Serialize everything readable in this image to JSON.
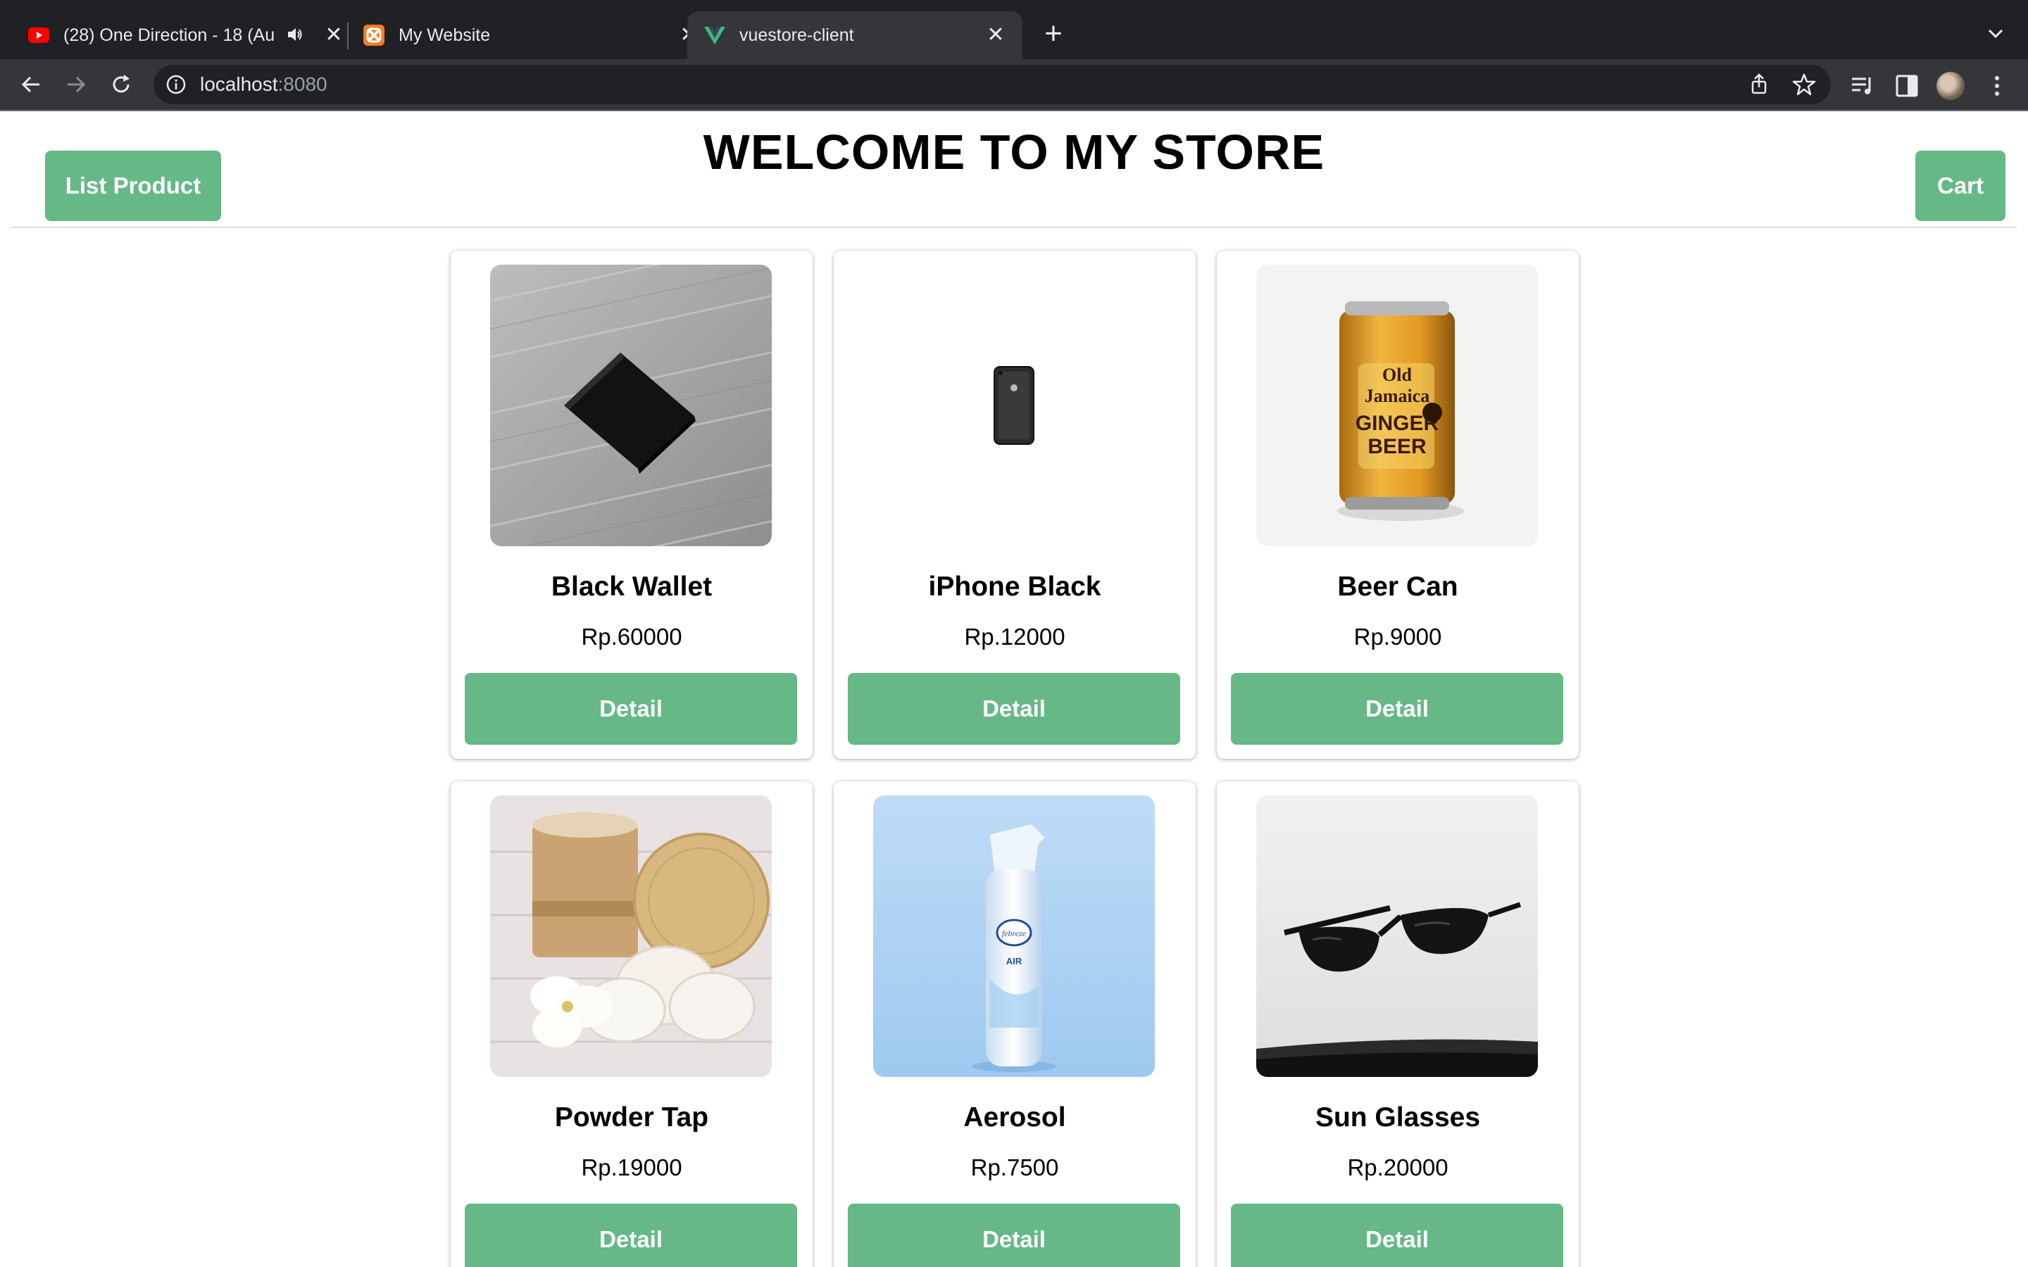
{
  "browser": {
    "tabs": [
      {
        "title": "(28) One Direction - 18 (Au",
        "favicon": "youtube-icon"
      },
      {
        "title": "My Website",
        "favicon": "xampp-icon"
      },
      {
        "title": "vuestore-client",
        "favicon": "vue-icon"
      }
    ],
    "url_host": "localhost",
    "url_port": ":8080"
  },
  "page": {
    "title": "WELCOME TO MY STORE",
    "list_product_label": "List Product",
    "cart_label": "Cart"
  },
  "products": [
    {
      "name": "Black Wallet",
      "price": "Rp.60000",
      "detail_label": "Detail",
      "image": "black-wallet"
    },
    {
      "name": "iPhone Black",
      "price": "Rp.12000",
      "detail_label": "Detail",
      "image": "iphone-black"
    },
    {
      "name": "Beer Can",
      "price": "Rp.9000",
      "detail_label": "Detail",
      "image": "beer-can"
    },
    {
      "name": "Powder Tap",
      "price": "Rp.19000",
      "detail_label": "Detail",
      "image": "powder-tap"
    },
    {
      "name": "Aerosol",
      "price": "Rp.7500",
      "detail_label": "Detail",
      "image": "aerosol"
    },
    {
      "name": "Sun Glasses",
      "price": "Rp.20000",
      "detail_label": "Detail",
      "image": "sun-glasses"
    }
  ],
  "colors": {
    "accent_green": "#66b887",
    "tabbar_bg": "#202124",
    "toolbar_bg": "#35363a"
  }
}
